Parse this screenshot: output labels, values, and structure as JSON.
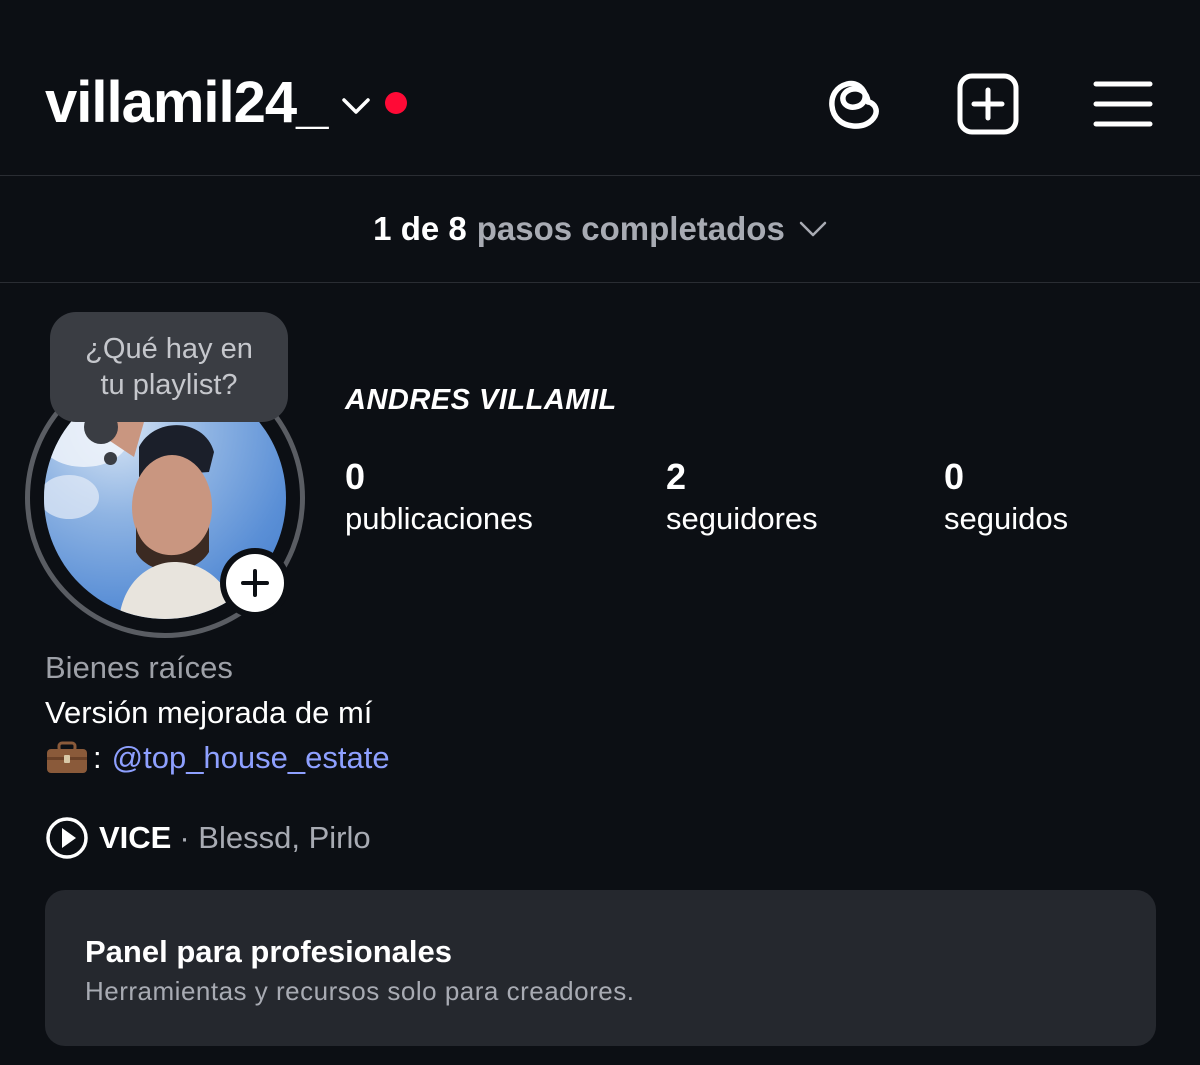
{
  "header": {
    "username": "villamil24_",
    "notification_dot_color": "#ff0a36",
    "icons": [
      "threads-icon",
      "add-post-icon",
      "menu-icon"
    ]
  },
  "steps": {
    "count": "1 de 8",
    "text": "pasos completados"
  },
  "profile": {
    "note_bubble": "¿Qué hay en\ntu playlist?",
    "display_name": "ANDRES VILLAMIL",
    "stats": [
      {
        "value": "0",
        "label": "publicaciones"
      },
      {
        "value": "2",
        "label": "seguidores"
      },
      {
        "value": "0",
        "label": "seguidos"
      }
    ]
  },
  "bio": {
    "category": "Bienes raíces",
    "line": "Versión mejorada de mí",
    "work_separator": ":",
    "work_mention": "@top_house_estate",
    "mention_color": "#8ea0ff"
  },
  "music": {
    "title": "VICE",
    "artists": "· Blessd, Pirlo"
  },
  "pro_panel": {
    "title": "Panel para profesionales",
    "subtitle": "Herramientas y recursos solo para creadores."
  }
}
